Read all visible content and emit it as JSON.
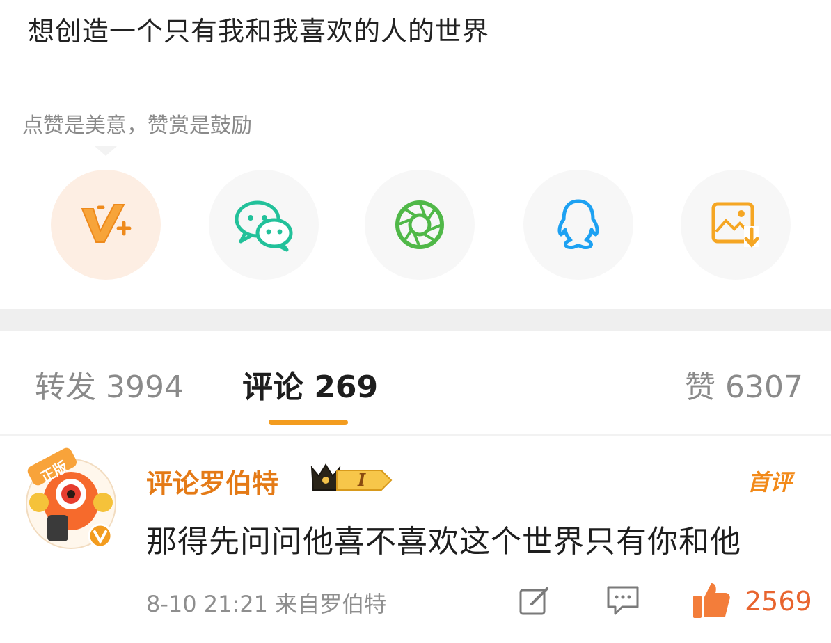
{
  "post": {
    "text": "想创造一个只有我和我喜欢的人的世界"
  },
  "reward_hint": "点赞是美意，赞赏是鼓励",
  "share_icons": [
    "v-plus-reward-icon",
    "wechat-icon",
    "moments-icon",
    "qq-icon",
    "save-image-icon"
  ],
  "tabs": {
    "repost": "转发 3994",
    "comments": "评论 269",
    "likes": "赞 6307"
  },
  "comment": {
    "username": "评论罗伯特",
    "level_badge": "I",
    "first_badge": "首评",
    "text": "那得先问问他喜不喜欢这个世界只有你和他",
    "meta": "8-10 21:21 来自罗伯特",
    "like_count": "2569",
    "avatar_tag": "正版"
  },
  "colors": {
    "accent": "#f39c1f",
    "username": "#e47a16",
    "like": "#e8642e",
    "wechat": "#22c19a",
    "moments": "#50b848",
    "qq": "#1da1f2"
  }
}
